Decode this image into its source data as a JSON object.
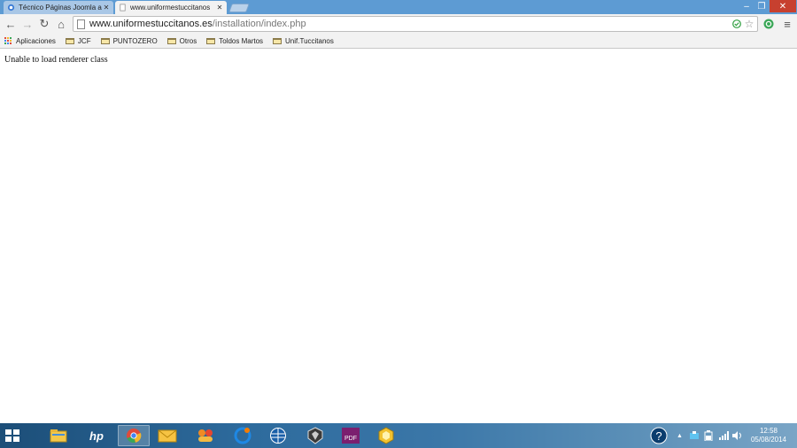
{
  "browser": {
    "tabs": [
      {
        "title": "Técnico Páginas Joomla a",
        "active": false
      },
      {
        "title": "www.uniformestuccitanos",
        "active": true
      }
    ],
    "window_controls": {
      "minimize": "‒",
      "maximize": "❐",
      "close": "✕"
    }
  },
  "toolbar": {
    "back": "←",
    "forward": "→",
    "reload": "↻",
    "home": "⌂",
    "url_host": "www.uniformestuccitanos.es",
    "url_path": "/installation/index.php",
    "star": "☆",
    "menu": "≡"
  },
  "bookmarks": {
    "apps_label": "Aplicaciones",
    "items": [
      "JCF",
      "PUNTOZERO",
      "Otros",
      "Toldos Martos",
      "Unif.Tuccitanos"
    ]
  },
  "page": {
    "message": "Unable to load renderer class"
  },
  "taskbar": {
    "apps": [
      {
        "icon": "file-explorer-icon",
        "label": "📁"
      },
      {
        "icon": "hp-icon",
        "label": "hp"
      },
      {
        "icon": "chrome-icon",
        "label": "◉"
      },
      {
        "icon": "mail-icon",
        "label": "✉"
      },
      {
        "icon": "people-icon",
        "label": "☻"
      },
      {
        "icon": "browser-icon",
        "label": "ℯ"
      },
      {
        "icon": "globe-icon",
        "label": "◍"
      },
      {
        "icon": "shield-icon",
        "label": "⬢"
      },
      {
        "icon": "pdf-icon",
        "label": "PDF"
      },
      {
        "icon": "hexagon-icon",
        "label": "⬡"
      }
    ],
    "help": "?",
    "clock_time": "12:58",
    "clock_date": "05/08/2014"
  },
  "colors": {
    "titlebar": "#5d9bd3",
    "toolbar": "#f2f2f2",
    "close_button": "#c7402f",
    "taskbar": "#2d6a9c"
  }
}
